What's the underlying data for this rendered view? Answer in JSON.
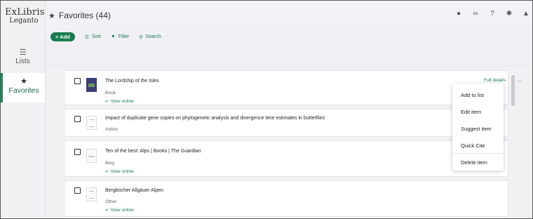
{
  "nav": {
    "logo": {
      "brand": "ExLibris",
      "product": "Leganto"
    },
    "items": [
      {
        "label": "Lists",
        "icon": "list-icon"
      },
      {
        "label": "Favorites",
        "icon": "star-icon"
      }
    ]
  },
  "header": {
    "title": "Favorites (44)",
    "toolbar": {
      "add": "+ Add",
      "sort": "Sort",
      "filter": "Filter",
      "search": "Search"
    },
    "icons": [
      "user-icon",
      "link-icon",
      "help-icon",
      "settings-icon",
      "bell-icon"
    ]
  },
  "items": [
    {
      "title": "The Lordship of the Isles",
      "type": "Book",
      "view_online": "View online"
    },
    {
      "title": "Impact of duplicate gene copies on phylogenetic analysis and divergence time estimates in butterflies",
      "type": "Article"
    },
    {
      "title": "Ten of the best: Alps | Books | The Guardian",
      "type": "Blog",
      "view_online": "View online",
      "thumb_text": "www"
    },
    {
      "title": "Bergbücher Allgäuer Alpen",
      "type": "Other",
      "view_online": "View online"
    }
  ],
  "item_actions": {
    "full_details": "Full details",
    "more": "..."
  },
  "menu": {
    "items": [
      "Add to list",
      "Edit item",
      "Suggest item",
      "Quick Cite",
      "Delete item"
    ]
  },
  "colors": {
    "accent": "#197d52",
    "link": "#1b7a50",
    "background": "#f1f1f4"
  }
}
